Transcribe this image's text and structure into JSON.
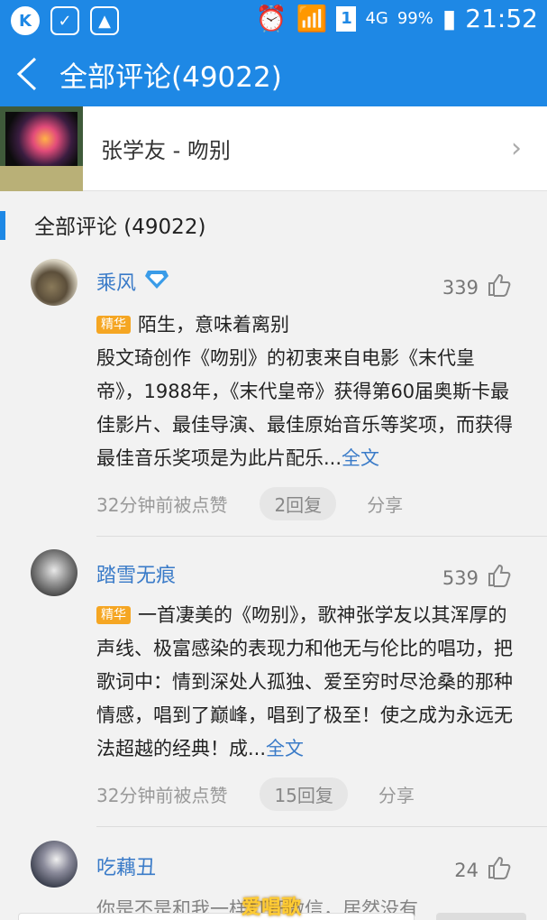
{
  "status_bar": {
    "signal": "4G",
    "battery": "99%",
    "time": "21:52",
    "sim": "1"
  },
  "header": {
    "title": "全部评论(49022)"
  },
  "song": {
    "title": "张学友 - 吻别"
  },
  "section": {
    "title": "全部评论 (49022)"
  },
  "comments": [
    {
      "user": "乘风",
      "likes": "339",
      "badge": "精华",
      "line1": "陌生，意味着离别",
      "text": "殷文琦创作《吻别》的初衷来自电影《末代皇帝》，1988年，《末代皇帝》获得第60届奥斯卡最佳影片、最佳导演、最佳原始音乐等奖项，而获得最佳音乐奖项是为此片配乐...",
      "more": "全文",
      "time": "32分钟前被点赞",
      "replies": "2回复",
      "share": "分享"
    },
    {
      "user": "踏雪无痕",
      "likes": "539",
      "badge": "精华",
      "text": "一首凄美的《吻别》，歌神张学友以其浑厚的声线、极富感染的表现力和他无与伦比的唱功，把歌词中：情到深处人孤独、爱至穷时尽沧桑的那种情感，唱到了巅峰，唱到了极至！使之成为永远无法超越的经典！成...",
      "more": "全文",
      "time": "32分钟前被点赞",
      "replies": "15回复",
      "share": "分享"
    },
    {
      "user": "吃藕丑",
      "likes": "24",
      "text": "你是不是和我一样打开微信，居然没有"
    }
  ],
  "watermark": "爱唱歌"
}
